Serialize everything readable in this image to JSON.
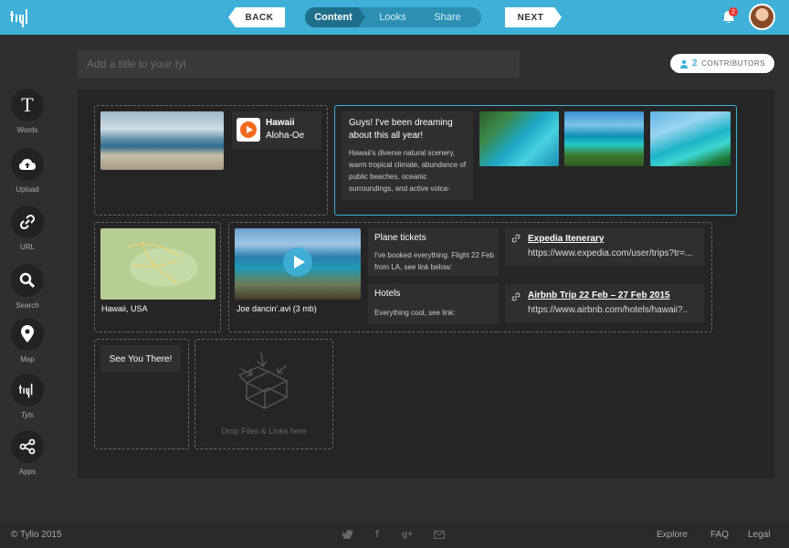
{
  "topbar": {
    "back_label": "BACK",
    "next_label": "NEXT",
    "steps": [
      "Content",
      "Looks",
      "Share"
    ],
    "notification_count": "2"
  },
  "title_input": {
    "placeholder": "Add a title to your tyl"
  },
  "contributors": {
    "count": "2",
    "label": "CONTRIBUTORS"
  },
  "sidebar": {
    "items": [
      {
        "label": "Words",
        "icon": "text-icon"
      },
      {
        "label": "Upload",
        "icon": "cloud-upload-icon"
      },
      {
        "label": "URL",
        "icon": "link-icon"
      },
      {
        "label": "Search",
        "icon": "search-icon"
      },
      {
        "label": "Map",
        "icon": "map-pin-icon"
      },
      {
        "label": "Tyls",
        "icon": "tyl-logo-icon"
      },
      {
        "label": "Apps",
        "icon": "share-icon"
      }
    ]
  },
  "canvas": {
    "music": {
      "title": "Hawaii",
      "subtitle": "Aloha-Oe"
    },
    "note": {
      "heading": "Guys! I've been dreaming about this all year!",
      "body": "Hawaii's diverse natural scenery, warm tropical climate, abundance of public beaches, oceanic surroundings, and active volca-"
    },
    "map": {
      "caption": "Hawaii, USA"
    },
    "video": {
      "caption": "Joe dancin'.avi (3 mb)"
    },
    "plane": {
      "title": "Plane tickets",
      "body": "I've booked everything. Flight 22 Feb from LA, see link below:"
    },
    "hotels": {
      "title": "Hotels",
      "body": "Everything cool, see link:"
    },
    "link1": {
      "title": "Expedia Itenerary",
      "url": "https://www.expedia.com/user/trips?tr=..."
    },
    "link2": {
      "title": "Airbnb Trip 22 Feb – 27 Feb 2015",
      "url": "https://www.airbnb.com/hotels/hawaii?.."
    },
    "note2": {
      "text": "See You There!"
    },
    "drop": {
      "text": "Drop Files & Links here"
    }
  },
  "footer": {
    "copyright": "© Tylio 2015",
    "links": [
      "Explore",
      "FAQ",
      "Legal"
    ],
    "social_icons": [
      "twitter-icon",
      "facebook-icon",
      "google-plus-icon",
      "mail-icon"
    ]
  },
  "colors": {
    "accent": "#3fb0d8",
    "background": "#2f2f2f",
    "canvas": "#252525"
  }
}
